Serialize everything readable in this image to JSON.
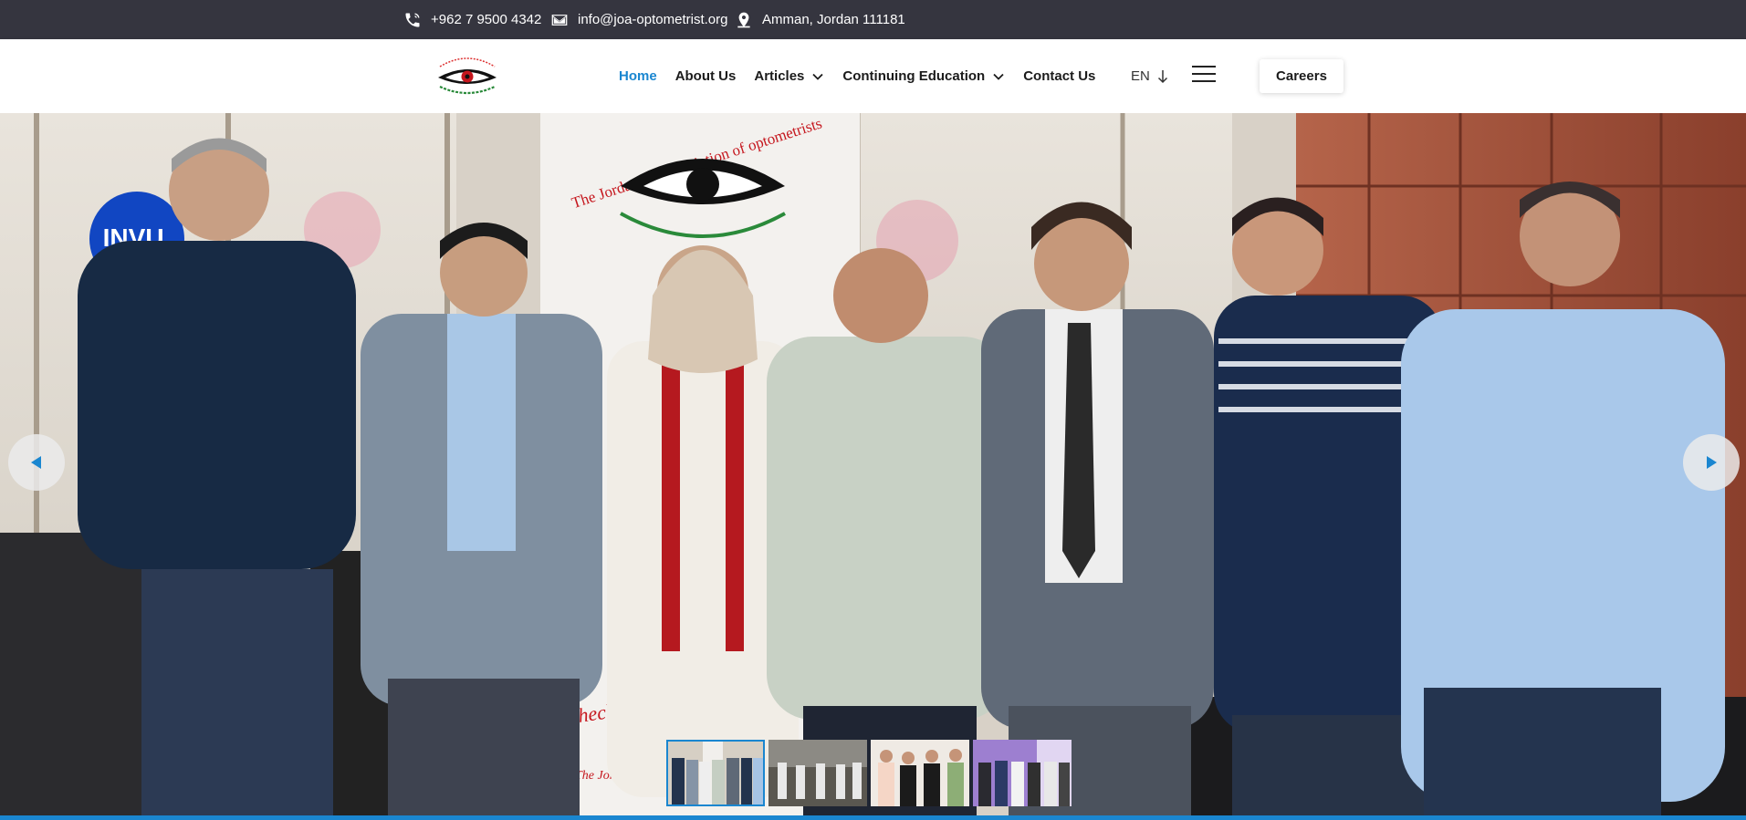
{
  "topbar": {
    "phone": "+962 7 9500 4342",
    "email": "info@joa-optometrist.org",
    "location": "Amman, Jordan 111181",
    "icons": [
      "phone-icon",
      "envelope-icon",
      "location-pin-icon"
    ],
    "background": "#35353f"
  },
  "header": {
    "nav": {
      "home": "Home",
      "about": "About Us",
      "articles": "Articles",
      "education": "Continuing Education",
      "contact": "Contact Us"
    },
    "language": "EN",
    "careers_label": "Careers"
  },
  "hero": {
    "banner_title": "The Jordanian Association of optometrists",
    "banner_tagline": "Check Y",
    "banner_footer": "The Jorda",
    "sign_text": "INVU.",
    "thumbnail_count": 4,
    "active_thumbnail": 1
  },
  "colors": {
    "accent": "#1a86d0",
    "topbar": "#35353f",
    "text": "#1b1b1b"
  }
}
